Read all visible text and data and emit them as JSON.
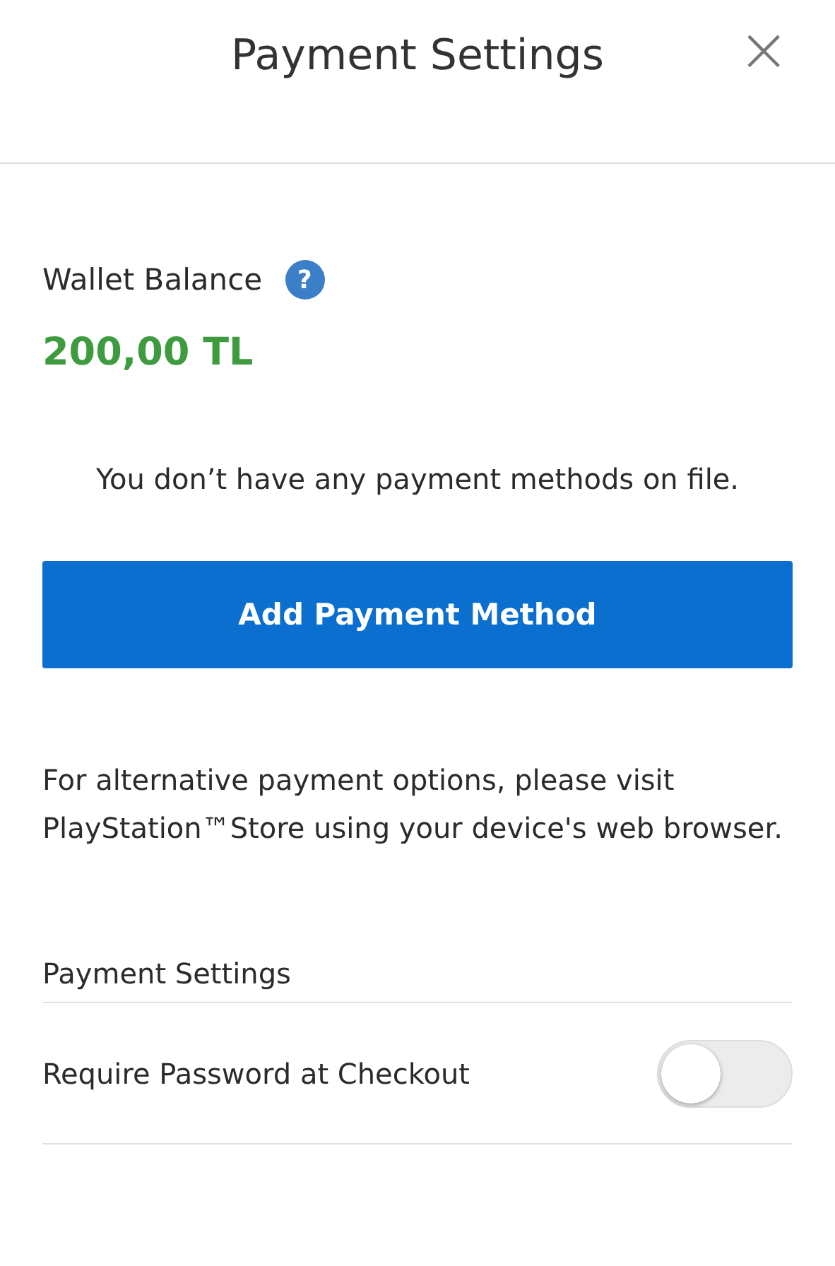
{
  "header": {
    "title": "Payment Settings",
    "close": "×"
  },
  "wallet": {
    "label": "Wallet Balance",
    "help": "?",
    "amount": "200,00 TL"
  },
  "empty_message": "You don’t have any payment methods on file.",
  "add_button": "Add Payment Method",
  "alternative_note": "For alternative payment options, please visit PlayStation™Store using your device's web browser.",
  "settings": {
    "heading": "Payment Settings",
    "items": [
      {
        "label": "Require Password at Checkout",
        "on": false
      }
    ]
  }
}
